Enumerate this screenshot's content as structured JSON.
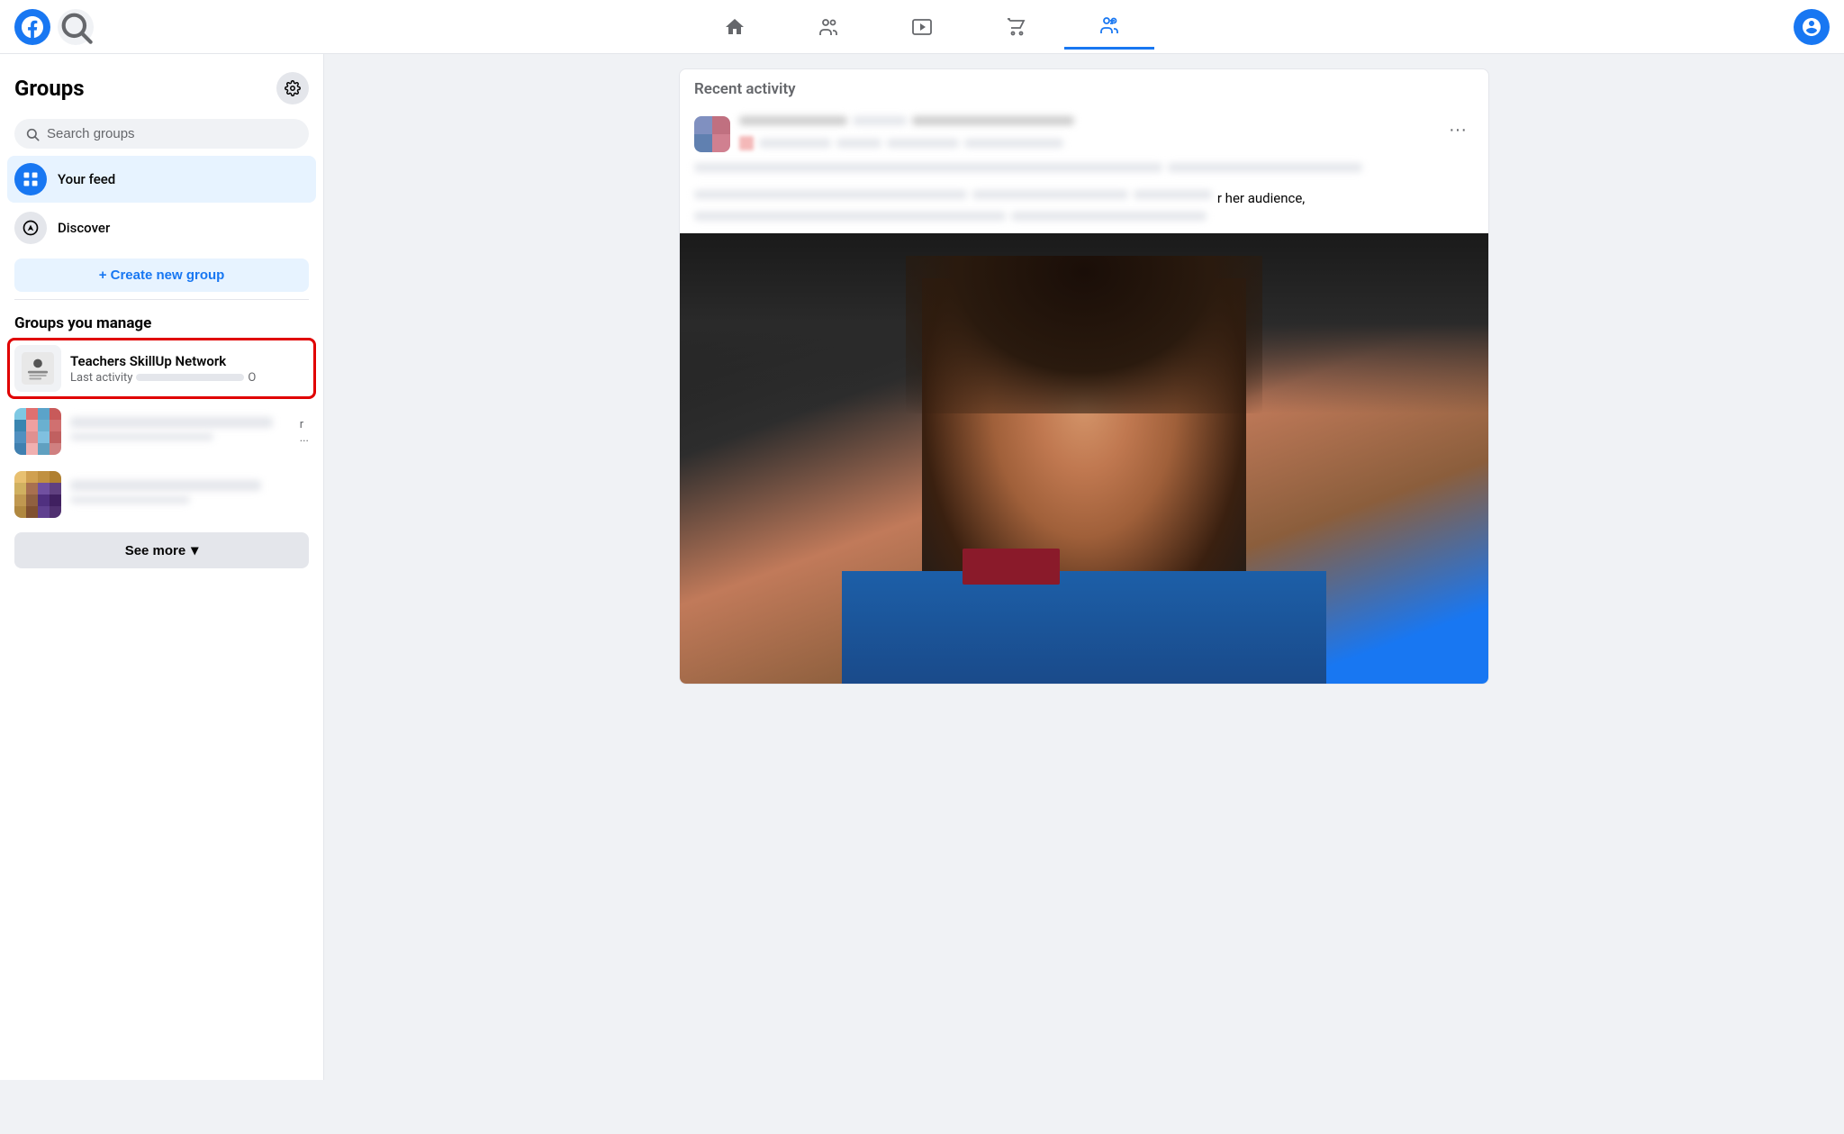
{
  "app": {
    "name": "Facebook"
  },
  "nav": {
    "search_label": "Search",
    "icons": [
      "home",
      "friends",
      "watch",
      "marketplace",
      "groups"
    ],
    "active_tab": "groups"
  },
  "sidebar": {
    "title": "Groups",
    "search_placeholder": "Search groups",
    "nav_items": [
      {
        "id": "your-feed",
        "label": "Your feed",
        "icon_type": "blue"
      },
      {
        "id": "discover",
        "label": "Discover",
        "icon_type": "gray"
      }
    ],
    "create_group_label": "+ Create new group",
    "sections": [
      {
        "title": "Groups you manage",
        "groups": [
          {
            "id": "tsn",
            "name": "Teachers SkillUp Network",
            "sub": "Last activity",
            "highlighted": true
          },
          {
            "id": "group2",
            "name": "",
            "sub": "",
            "highlighted": false
          },
          {
            "id": "group3",
            "name": "",
            "sub": "",
            "highlighted": false
          }
        ]
      }
    ],
    "see_more_label": "See more",
    "chevron_down": "▾"
  },
  "main": {
    "recent_activity_label": "Recent activity",
    "post_text_visible": "r her audience,",
    "three_dots_label": "···"
  }
}
